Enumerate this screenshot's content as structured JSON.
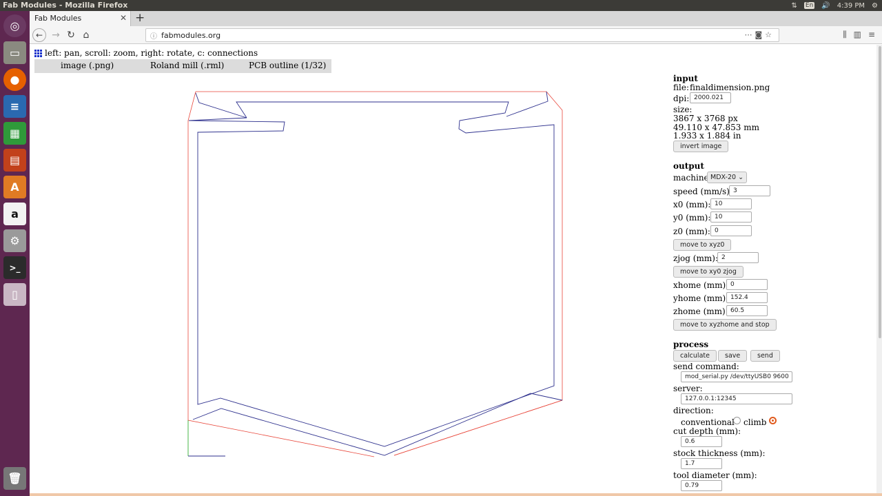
{
  "system": {
    "window_title": "Fab Modules - Mozilla Firefox",
    "language": "En",
    "time": "4:39 PM"
  },
  "launcher": {
    "items": [
      "dash-icon",
      "files-icon",
      "firefox-icon",
      "writer-icon",
      "calc-icon",
      "impress-icon",
      "software-center-icon",
      "amazon-icon",
      "settings-icon",
      "terminal-icon",
      "usb-drive-icon",
      "trash-icon"
    ]
  },
  "browser": {
    "tab_title": "Fab Modules",
    "url": "fabmodules.org"
  },
  "page": {
    "hint": "left: pan, scroll: zoom, right: rotate, c: connections",
    "menu": {
      "input": "image (.png)",
      "output": "Roland mill (.rml)",
      "process": "PCB outline (1/32)"
    }
  },
  "input": {
    "heading": "input",
    "file_label": "file:",
    "file_name": "finaldimension.png",
    "dpi_label": "dpi:",
    "dpi_value": "2000.021",
    "size_label": "size:",
    "size_px": "3867 x 3768 px",
    "size_mm": "49.110 x 47.853 mm",
    "size_in": "1.933 x 1.884 in",
    "invert_button": "invert image"
  },
  "output": {
    "heading": "output",
    "machine_label": "machine",
    "machine_value": "MDX-20",
    "speed_label": "speed (mm/s):",
    "speed_value": "3",
    "x0_label": "x0 (mm):",
    "x0_value": "10",
    "y0_label": "y0 (mm):",
    "y0_value": "10",
    "z0_label": "z0 (mm):",
    "z0_value": "0",
    "move_xyz0_button": "move to xyz0",
    "zjog_label": "zjog (mm):",
    "zjog_value": "2",
    "move_xy0zjog_button": "move to xy0 zjog",
    "xhome_label": "xhome (mm):",
    "xhome_value": "0",
    "yhome_label": "yhome (mm):",
    "yhome_value": "152.4",
    "zhome_label": "zhome (mm):",
    "zhome_value": "60.5",
    "move_home_button": "move to xyzhome and stop"
  },
  "process": {
    "heading": "process",
    "calculate_button": "calculate",
    "save_button": "save",
    "send_button": "send",
    "send_command_label": "send command:",
    "send_command_value": "mod_serial.py /dev/ttyUSB0 9600",
    "server_label": "server:",
    "server_value": "127.0.0.1:12345",
    "direction_label": "direction:",
    "conventional_label": "conventional",
    "climb_label": "climb",
    "direction_selected": "climb",
    "cut_depth_label": "cut depth (mm):",
    "cut_depth_value": "0.6",
    "stock_thickness_label": "stock thickness (mm):",
    "stock_thickness_value": "1.7",
    "tool_diameter_label": "tool diameter (mm):",
    "tool_diameter_value": "0.79"
  },
  "colors": {
    "toolpath": "#2b2e8c",
    "travel": "#e8463a",
    "axis": "#1aa51a",
    "radio_accent": "#e05a1c"
  }
}
